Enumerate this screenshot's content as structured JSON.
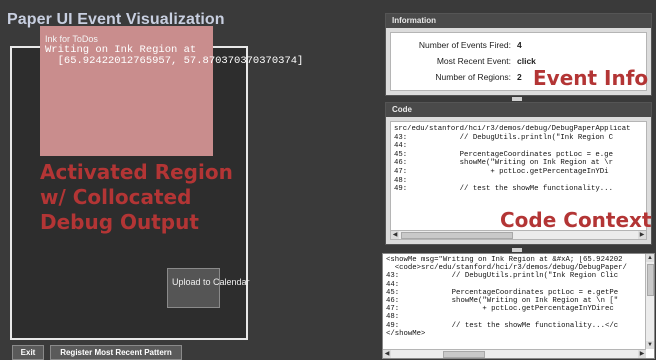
{
  "app": {
    "title": "Paper UI Event Visualization"
  },
  "canvas": {
    "region": {
      "title": "Ink for ToDos",
      "message": "Writing on Ink Region at\n  [65.92422012765957, 57.870370370370374]"
    },
    "overlay_label": "Activated Region w/ Collocated Debug Output",
    "upload_button": "Upload to Calendar"
  },
  "footer": {
    "exit_label": "Exit",
    "register_label": "Register Most Recent Pattern"
  },
  "info_panel": {
    "header": "Information",
    "events_fired_label": "Number of Events Fired:",
    "events_fired_value": "4",
    "recent_event_label": "Most Recent Event:",
    "recent_event_value": "click",
    "regions_label": "Number of Regions:",
    "regions_value": "2",
    "overlay_label": "Event Info"
  },
  "code_panel": {
    "header": "Code",
    "code": "src/edu/stanford/hci/r3/demos/debug/DebugPaperApplicat\n43:            // DebugUtils.println(\"Ink Region C\n44:\n45:            PercentageCoordinates pctLoc = e.ge\n46:            showMe(\"Writing on Ink Region at \\r\n47:                   + pctLoc.getPercentageInYDi\n48:\n49:            // test the showMe functionality...",
    "overlay_label": "Code Context"
  },
  "xml_panel": {
    "text": "<showMe msg=\"Writing on Ink Region at &#xA; [65.924202\n  <code>src/edu/stanford/hci/r3/demos/debug/DebugPaper/\n43:            // DebugUtils.println(\"Ink Region Clic\n44:\n45:            PercentageCoordinates pctLoc = e.getPe\n46:            showMe(\"Writing on Ink Region at \\n [\"\n47:                   + pctLoc.getPercentageInYDirec\n48:\n49:            // test the showMe functionality...</c\n</showMe>"
  },
  "colors": {
    "background": "#3a3a3a",
    "ink_region": "#c98d8d",
    "annotation_red": "#b33535"
  }
}
